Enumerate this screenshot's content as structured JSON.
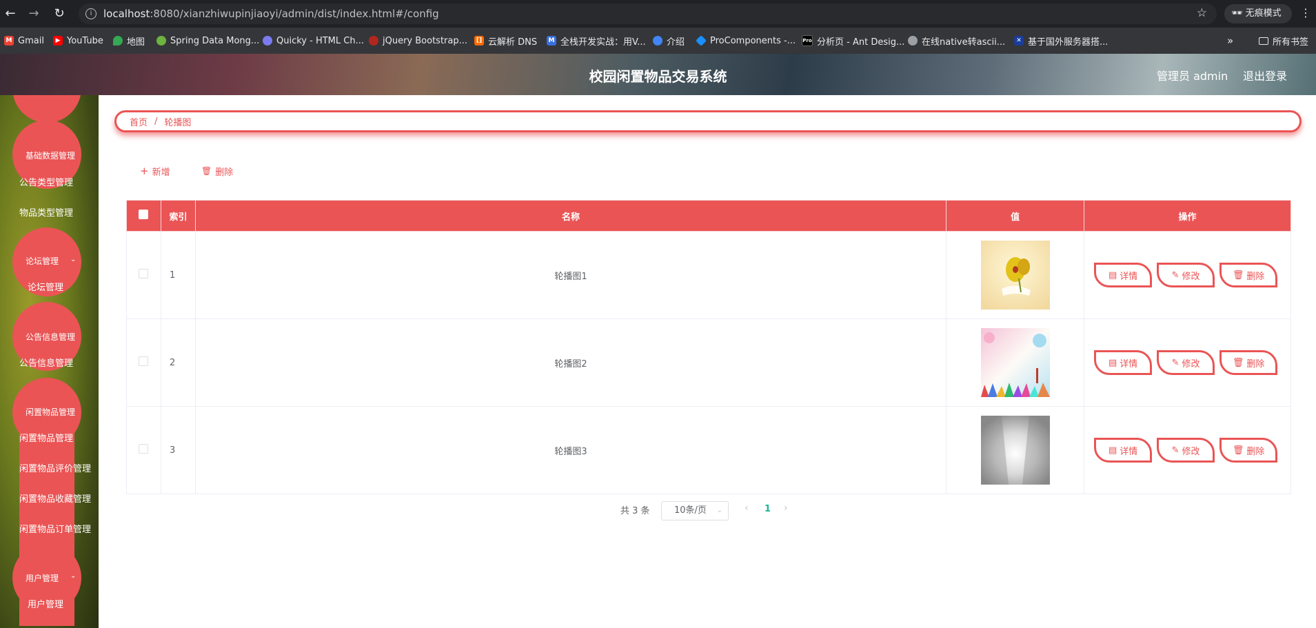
{
  "browser": {
    "url_host": "localhost",
    "url_rest": ":8080/xianzhiwupinjiaoyi/admin/dist/index.html#/config",
    "incognito_label": "无痕模式",
    "bookmarks": [
      {
        "label": "Gmail",
        "icon": "gmail-icon",
        "color": "#ea4335"
      },
      {
        "label": "YouTube",
        "icon": "youtube-icon",
        "color": "#ff0000"
      },
      {
        "label": "地图",
        "icon": "maps-icon",
        "color": "#34a853"
      },
      {
        "label": "Spring Data Mong...",
        "icon": "spring-icon",
        "color": "#6db33f"
      },
      {
        "label": "Quicky - HTML Ch...",
        "icon": "quicky-icon",
        "color": "#7b7bf0"
      },
      {
        "label": "jQuery Bootstrap...",
        "icon": "jquery-icon",
        "color": "#b3261e"
      },
      {
        "label": "云解析 DNS",
        "icon": "aliyun-icon",
        "color": "#ff6a00"
      },
      {
        "label": "全栈开发实战：用V...",
        "icon": "m-icon",
        "color": "#3b6fe0"
      },
      {
        "label": "介绍",
        "icon": "globe-icon",
        "color": "#4285f4"
      },
      {
        "label": "ProComponents -...",
        "icon": "procomponents-icon",
        "color": "#1890ff"
      },
      {
        "label": "分析页 - Ant Desig...",
        "icon": "pro-icon",
        "color": "#000000"
      },
      {
        "label": "在线native转ascii...",
        "icon": "world-icon",
        "color": "#9aa0a6"
      },
      {
        "label": "基于国外服务器搭...",
        "icon": "flag-icon",
        "color": "#1a3d9c"
      }
    ],
    "all_bookmarks_label": "所有书签"
  },
  "header": {
    "title": "校园闲置物品交易系统",
    "user_label": "管理员 admin",
    "logout_label": "退出登录"
  },
  "sidebar": {
    "groups": [
      {
        "heading": "基础数据管理",
        "items": [
          "公告类型管理",
          "物品类型管理"
        ]
      },
      {
        "heading": "论坛管理",
        "items": [
          "论坛管理"
        ]
      },
      {
        "heading": "公告信息管理",
        "items": [
          "公告信息管理"
        ]
      },
      {
        "heading": "闲置物品管理",
        "items": [
          "闲置物品管理",
          "闲置物品评价管理",
          "闲置物品收藏管理",
          "闲置物品订单管理"
        ]
      },
      {
        "heading": "用户管理",
        "items": [
          "用户管理"
        ]
      }
    ]
  },
  "breadcrumb": {
    "home": "首页",
    "current": "轮播图"
  },
  "toolbar": {
    "add_label": "新增",
    "delete_label": "删除"
  },
  "table": {
    "headers": {
      "index": "索引",
      "name": "名称",
      "value": "值",
      "actions": "操作"
    },
    "rows": [
      {
        "index": "1",
        "name": "轮播图1",
        "image": "yellow-flower"
      },
      {
        "index": "2",
        "name": "轮播图2",
        "image": "colorful-crowd"
      },
      {
        "index": "3",
        "name": "轮播图3",
        "image": "gray-light"
      }
    ],
    "action_labels": {
      "detail": "详情",
      "edit": "修改",
      "delete": "删除"
    }
  },
  "pagination": {
    "total_text": "共 3 条",
    "page_size": "10条/页",
    "current_page": "1"
  },
  "colors": {
    "accent": "#ea5455",
    "page_active": "#1ab394"
  }
}
